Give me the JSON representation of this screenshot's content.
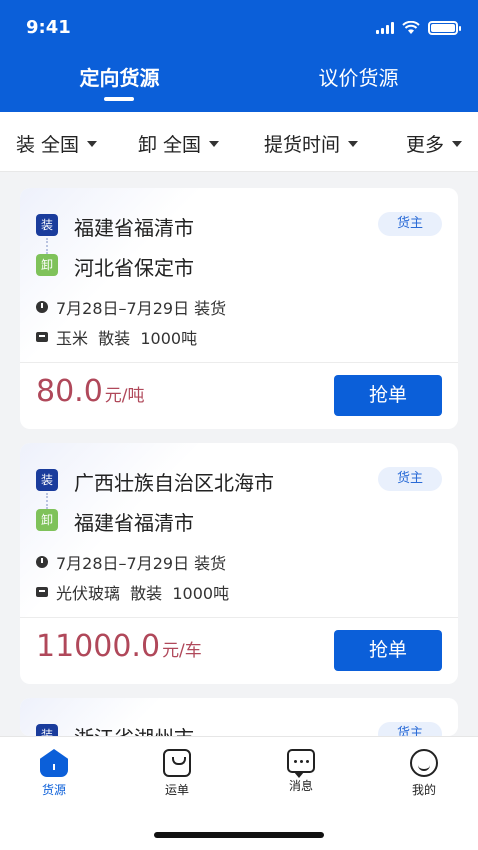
{
  "status": {
    "time": "9:41"
  },
  "tabs": [
    {
      "label": "定向货源",
      "active": true
    },
    {
      "label": "议价货源",
      "active": false
    }
  ],
  "filters": [
    {
      "label": "装 全国"
    },
    {
      "label": "卸 全国"
    },
    {
      "label": "提货时间"
    },
    {
      "label": "更多"
    }
  ],
  "cards": [
    {
      "load_tag": "装",
      "unload_tag": "卸",
      "from": "福建省福清市",
      "to": "河北省保定市",
      "owner": "货主",
      "time": "7月28日–7月29日 装货",
      "cargo": "玉米  散装  1000吨",
      "price": "80.0",
      "unit": "元/吨",
      "action": "抢单"
    },
    {
      "load_tag": "装",
      "unload_tag": "卸",
      "from": "广西壮族自治区北海市",
      "to": "福建省福清市",
      "owner": "货主",
      "time": "7月28日–7月29日 装货",
      "cargo": "光伏玻璃  散装  1000吨",
      "price": "11000.0",
      "unit": "元/车",
      "action": "抢单"
    },
    {
      "load_tag": "装",
      "from": "浙江省湖州市",
      "owner": "货主"
    }
  ],
  "nav": [
    {
      "label": "货源",
      "icon": "home-icon",
      "active": true
    },
    {
      "label": "运单",
      "icon": "order-icon",
      "active": false
    },
    {
      "label": "消息",
      "icon": "message-icon",
      "active": false
    },
    {
      "label": "我的",
      "icon": "profile-icon",
      "active": false
    }
  ],
  "colors": {
    "primary": "#0b5fd9",
    "price": "#b0485a",
    "load_tag": "#1a3c9c",
    "unload_tag": "#7fc25a"
  }
}
